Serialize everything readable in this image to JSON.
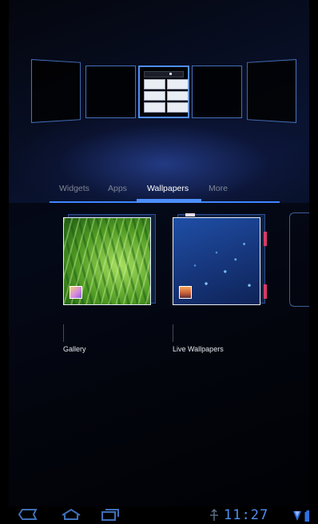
{
  "tabs": {
    "widgets": "Widgets",
    "apps": "Apps",
    "wallpapers": "Wallpapers",
    "more": "More",
    "selected": "Wallpapers"
  },
  "wallpapers": [
    {
      "label": "Gallery",
      "icon": "gallery-icon"
    },
    {
      "label": "Live Wallpapers",
      "icon": "live-wallpapers-icon"
    }
  ],
  "status": {
    "time": "11:27",
    "icons": [
      "usb-icon",
      "signal-icon",
      "battery-icon"
    ]
  },
  "nav": {
    "icons": [
      "back-icon",
      "home-icon",
      "recent-apps-icon"
    ]
  },
  "colors": {
    "accent": "#4d8fff",
    "clock": "#4f8ff0"
  }
}
